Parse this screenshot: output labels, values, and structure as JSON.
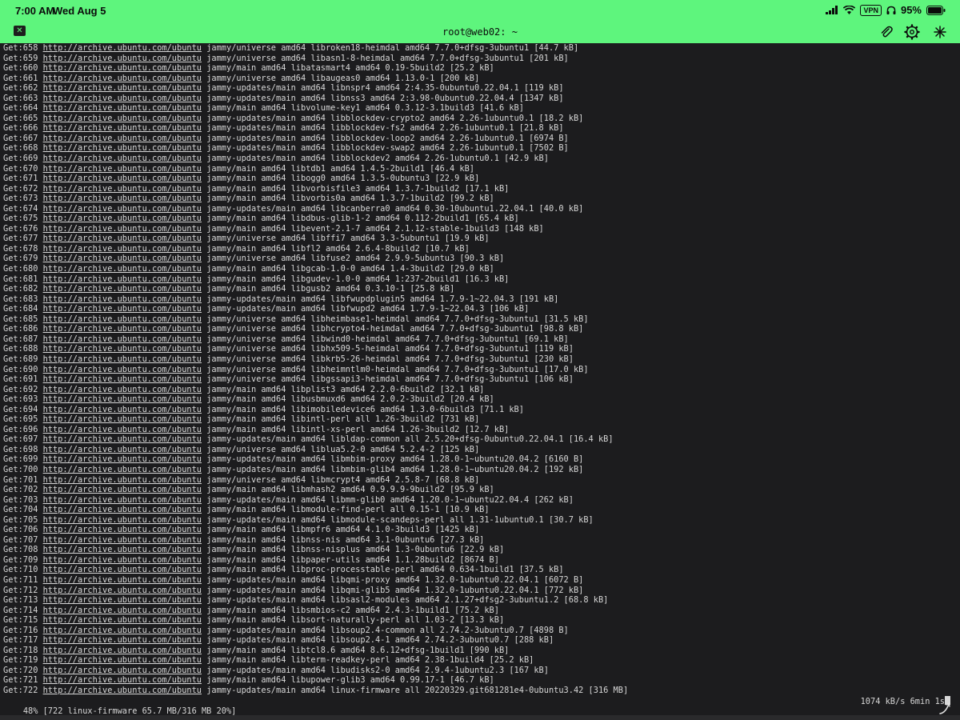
{
  "status_bar": {
    "time": "7:00 AM",
    "date": "Wed Aug 5",
    "vpn": "VPN",
    "battery": "95%"
  },
  "window": {
    "title": "root@web02: ~",
    "close_symbol": "✕",
    "icons": [
      "paperclip-icon",
      "gear-icon",
      "more-icon"
    ]
  },
  "colors": {
    "accent": "#5ef57d",
    "terminal_bg": "#1c1c1e",
    "terminal_fg": "#d8d8d8"
  },
  "terminal": {
    "lines": [
      {
        "prefix": "Get:658",
        "url": "http://archive.ubuntu.com/ubuntu",
        "rest": "jammy/universe amd64 libroken18-heimdal amd64 7.7.0+dfsg-3ubuntu1 [44.7 kB]"
      },
      {
        "prefix": "Get:659",
        "url": "http://archive.ubuntu.com/ubuntu",
        "rest": "jammy/universe amd64 libasn1-8-heimdal amd64 7.7.0+dfsg-3ubuntu1 [201 kB]"
      },
      {
        "prefix": "Get:660",
        "url": "http://archive.ubuntu.com/ubuntu",
        "rest": "jammy/main amd64 libatasmart4 amd64 0.19-5build2 [25.2 kB]"
      },
      {
        "prefix": "Get:661",
        "url": "http://archive.ubuntu.com/ubuntu",
        "rest": "jammy/universe amd64 libaugeas0 amd64 1.13.0-1 [200 kB]"
      },
      {
        "prefix": "Get:662",
        "url": "http://archive.ubuntu.com/ubuntu",
        "rest": "jammy-updates/main amd64 libnspr4 amd64 2:4.35-0ubuntu0.22.04.1 [119 kB]"
      },
      {
        "prefix": "Get:663",
        "url": "http://archive.ubuntu.com/ubuntu",
        "rest": "jammy-updates/main amd64 libnss3 amd64 2:3.98-0ubuntu0.22.04.4 [1347 kB]"
      },
      {
        "prefix": "Get:664",
        "url": "http://archive.ubuntu.com/ubuntu",
        "rest": "jammy/main amd64 libvolume-key1 amd64 0.3.12-3.1build3 [41.6 kB]"
      },
      {
        "prefix": "Get:665",
        "url": "http://archive.ubuntu.com/ubuntu",
        "rest": "jammy-updates/main amd64 libblockdev-crypto2 amd64 2.26-1ubuntu0.1 [18.2 kB]"
      },
      {
        "prefix": "Get:666",
        "url": "http://archive.ubuntu.com/ubuntu",
        "rest": "jammy-updates/main amd64 libblockdev-fs2 amd64 2.26-1ubuntu0.1 [21.8 kB]"
      },
      {
        "prefix": "Get:667",
        "url": "http://archive.ubuntu.com/ubuntu",
        "rest": "jammy-updates/main amd64 libblockdev-loop2 amd64 2.26-1ubuntu0.1 [6974 B]"
      },
      {
        "prefix": "Get:668",
        "url": "http://archive.ubuntu.com/ubuntu",
        "rest": "jammy-updates/main amd64 libblockdev-swap2 amd64 2.26-1ubuntu0.1 [7502 B]"
      },
      {
        "prefix": "Get:669",
        "url": "http://archive.ubuntu.com/ubuntu",
        "rest": "jammy-updates/main amd64 libblockdev2 amd64 2.26-1ubuntu0.1 [42.9 kB]"
      },
      {
        "prefix": "Get:670",
        "url": "http://archive.ubuntu.com/ubuntu",
        "rest": "jammy/main amd64 libtdb1 amd64 1.4.5-2build1 [46.4 kB]"
      },
      {
        "prefix": "Get:671",
        "url": "http://archive.ubuntu.com/ubuntu",
        "rest": "jammy/main amd64 libogg0 amd64 1.3.5-0ubuntu3 [22.9 kB]"
      },
      {
        "prefix": "Get:672",
        "url": "http://archive.ubuntu.com/ubuntu",
        "rest": "jammy/main amd64 libvorbisfile3 amd64 1.3.7-1build2 [17.1 kB]"
      },
      {
        "prefix": "Get:673",
        "url": "http://archive.ubuntu.com/ubuntu",
        "rest": "jammy/main amd64 libvorbis0a amd64 1.3.7-1build2 [99.2 kB]"
      },
      {
        "prefix": "Get:674",
        "url": "http://archive.ubuntu.com/ubuntu",
        "rest": "jammy-updates/main amd64 libcanberra0 amd64 0.30-10ubuntu1.22.04.1 [40.0 kB]"
      },
      {
        "prefix": "Get:675",
        "url": "http://archive.ubuntu.com/ubuntu",
        "rest": "jammy/main amd64 libdbus-glib-1-2 amd64 0.112-2build1 [65.4 kB]"
      },
      {
        "prefix": "Get:676",
        "url": "http://archive.ubuntu.com/ubuntu",
        "rest": "jammy/main amd64 libevent-2.1-7 amd64 2.1.12-stable-1build3 [148 kB]"
      },
      {
        "prefix": "Get:677",
        "url": "http://archive.ubuntu.com/ubuntu",
        "rest": "jammy/universe amd64 libffi7 amd64 3.3-5ubuntu1 [19.9 kB]"
      },
      {
        "prefix": "Get:678",
        "url": "http://archive.ubuntu.com/ubuntu",
        "rest": "jammy/main amd64 libfl2 amd64 2.6.4-8build2 [10.7 kB]"
      },
      {
        "prefix": "Get:679",
        "url": "http://archive.ubuntu.com/ubuntu",
        "rest": "jammy/universe amd64 libfuse2 amd64 2.9.9-5ubuntu3 [90.3 kB]"
      },
      {
        "prefix": "Get:680",
        "url": "http://archive.ubuntu.com/ubuntu",
        "rest": "jammy/main amd64 libgcab-1.0-0 amd64 1.4-3build2 [29.0 kB]"
      },
      {
        "prefix": "Get:681",
        "url": "http://archive.ubuntu.com/ubuntu",
        "rest": "jammy/main amd64 libgudev-1.0-0 amd64 1:237-2build1 [16.3 kB]"
      },
      {
        "prefix": "Get:682",
        "url": "http://archive.ubuntu.com/ubuntu",
        "rest": "jammy/main amd64 libgusb2 amd64 0.3.10-1 [25.8 kB]"
      },
      {
        "prefix": "Get:683",
        "url": "http://archive.ubuntu.com/ubuntu",
        "rest": "jammy-updates/main amd64 libfwupdplugin5 amd64 1.7.9-1~22.04.3 [191 kB]"
      },
      {
        "prefix": "Get:684",
        "url": "http://archive.ubuntu.com/ubuntu",
        "rest": "jammy-updates/main amd64 libfwupd2 amd64 1.7.9-1~22.04.3 [106 kB]"
      },
      {
        "prefix": "Get:685",
        "url": "http://archive.ubuntu.com/ubuntu",
        "rest": "jammy/universe amd64 libheimbase1-heimdal amd64 7.7.0+dfsg-3ubuntu1 [31.5 kB]"
      },
      {
        "prefix": "Get:686",
        "url": "http://archive.ubuntu.com/ubuntu",
        "rest": "jammy/universe amd64 libhcrypto4-heimdal amd64 7.7.0+dfsg-3ubuntu1 [98.8 kB]"
      },
      {
        "prefix": "Get:687",
        "url": "http://archive.ubuntu.com/ubuntu",
        "rest": "jammy/universe amd64 libwind0-heimdal amd64 7.7.0+dfsg-3ubuntu1 [69.1 kB]"
      },
      {
        "prefix": "Get:688",
        "url": "http://archive.ubuntu.com/ubuntu",
        "rest": "jammy/universe amd64 libhx509-5-heimdal amd64 7.7.0+dfsg-3ubuntu1 [119 kB]"
      },
      {
        "prefix": "Get:689",
        "url": "http://archive.ubuntu.com/ubuntu",
        "rest": "jammy/universe amd64 libkrb5-26-heimdal amd64 7.7.0+dfsg-3ubuntu1 [230 kB]"
      },
      {
        "prefix": "Get:690",
        "url": "http://archive.ubuntu.com/ubuntu",
        "rest": "jammy/universe amd64 libheimntlm0-heimdal amd64 7.7.0+dfsg-3ubuntu1 [17.0 kB]"
      },
      {
        "prefix": "Get:691",
        "url": "http://archive.ubuntu.com/ubuntu",
        "rest": "jammy/universe amd64 libgssapi3-heimdal amd64 7.7.0+dfsg-3ubuntu1 [106 kB]"
      },
      {
        "prefix": "Get:692",
        "url": "http://archive.ubuntu.com/ubuntu",
        "rest": "jammy/main amd64 libplist3 amd64 2.2.0-6build2 [32.1 kB]"
      },
      {
        "prefix": "Get:693",
        "url": "http://archive.ubuntu.com/ubuntu",
        "rest": "jammy/main amd64 libusbmuxd6 amd64 2.0.2-3build2 [20.4 kB]"
      },
      {
        "prefix": "Get:694",
        "url": "http://archive.ubuntu.com/ubuntu",
        "rest": "jammy/main amd64 libimobiledevice6 amd64 1.3.0-6build3 [71.1 kB]"
      },
      {
        "prefix": "Get:695",
        "url": "http://archive.ubuntu.com/ubuntu",
        "rest": "jammy/main amd64 libintl-perl all 1.26-3build2 [731 kB]"
      },
      {
        "prefix": "Get:696",
        "url": "http://archive.ubuntu.com/ubuntu",
        "rest": "jammy/main amd64 libintl-xs-perl amd64 1.26-3build2 [12.7 kB]"
      },
      {
        "prefix": "Get:697",
        "url": "http://archive.ubuntu.com/ubuntu",
        "rest": "jammy-updates/main amd64 libldap-common all 2.5.20+dfsg-0ubuntu0.22.04.1 [16.4 kB]"
      },
      {
        "prefix": "Get:698",
        "url": "http://archive.ubuntu.com/ubuntu",
        "rest": "jammy/universe amd64 liblua5.2-0 amd64 5.2.4-2 [125 kB]"
      },
      {
        "prefix": "Get:699",
        "url": "http://archive.ubuntu.com/ubuntu",
        "rest": "jammy-updates/main amd64 libmbim-proxy amd64 1.28.0-1~ubuntu20.04.2 [6160 B]"
      },
      {
        "prefix": "Get:700",
        "url": "http://archive.ubuntu.com/ubuntu",
        "rest": "jammy-updates/main amd64 libmbim-glib4 amd64 1.28.0-1~ubuntu20.04.2 [192 kB]"
      },
      {
        "prefix": "Get:701",
        "url": "http://archive.ubuntu.com/ubuntu",
        "rest": "jammy/universe amd64 libmcrypt4 amd64 2.5.8-7 [68.8 kB]"
      },
      {
        "prefix": "Get:702",
        "url": "http://archive.ubuntu.com/ubuntu",
        "rest": "jammy/main amd64 libmhash2 amd64 0.9.9.9-9build2 [95.9 kB]"
      },
      {
        "prefix": "Get:703",
        "url": "http://archive.ubuntu.com/ubuntu",
        "rest": "jammy-updates/main amd64 libmm-glib0 amd64 1.20.0-1~ubuntu22.04.4 [262 kB]"
      },
      {
        "prefix": "Get:704",
        "url": "http://archive.ubuntu.com/ubuntu",
        "rest": "jammy/main amd64 libmodule-find-perl all 0.15-1 [10.9 kB]"
      },
      {
        "prefix": "Get:705",
        "url": "http://archive.ubuntu.com/ubuntu",
        "rest": "jammy-updates/main amd64 libmodule-scandeps-perl all 1.31-1ubuntu0.1 [30.7 kB]"
      },
      {
        "prefix": "Get:706",
        "url": "http://archive.ubuntu.com/ubuntu",
        "rest": "jammy/main amd64 libmpfr6 amd64 4.1.0-3build3 [1425 kB]"
      },
      {
        "prefix": "Get:707",
        "url": "http://archive.ubuntu.com/ubuntu",
        "rest": "jammy/main amd64 libnss-nis amd64 3.1-0ubuntu6 [27.3 kB]"
      },
      {
        "prefix": "Get:708",
        "url": "http://archive.ubuntu.com/ubuntu",
        "rest": "jammy/main amd64 libnss-nisplus amd64 1.3-0ubuntu6 [22.9 kB]"
      },
      {
        "prefix": "Get:709",
        "url": "http://archive.ubuntu.com/ubuntu",
        "rest": "jammy/main amd64 libpaper-utils amd64 1.1.28build2 [8674 B]"
      },
      {
        "prefix": "Get:710",
        "url": "http://archive.ubuntu.com/ubuntu",
        "rest": "jammy/main amd64 libproc-processtable-perl amd64 0.634-1build1 [37.5 kB]"
      },
      {
        "prefix": "Get:711",
        "url": "http://archive.ubuntu.com/ubuntu",
        "rest": "jammy-updates/main amd64 libqmi-proxy amd64 1.32.0-1ubuntu0.22.04.1 [6072 B]"
      },
      {
        "prefix": "Get:712",
        "url": "http://archive.ubuntu.com/ubuntu",
        "rest": "jammy-updates/main amd64 libqmi-glib5 amd64 1.32.0-1ubuntu0.22.04.1 [772 kB]"
      },
      {
        "prefix": "Get:713",
        "url": "http://archive.ubuntu.com/ubuntu",
        "rest": "jammy-updates/main amd64 libsasl2-modules amd64 2.1.27+dfsg2-3ubuntu1.2 [68.8 kB]"
      },
      {
        "prefix": "Get:714",
        "url": "http://archive.ubuntu.com/ubuntu",
        "rest": "jammy/main amd64 libsmbios-c2 amd64 2.4.3-1build1 [75.2 kB]"
      },
      {
        "prefix": "Get:715",
        "url": "http://archive.ubuntu.com/ubuntu",
        "rest": "jammy/main amd64 libsort-naturally-perl all 1.03-2 [13.3 kB]"
      },
      {
        "prefix": "Get:716",
        "url": "http://archive.ubuntu.com/ubuntu",
        "rest": "jammy-updates/main amd64 libsoup2.4-common all 2.74.2-3ubuntu0.7 [4898 B]"
      },
      {
        "prefix": "Get:717",
        "url": "http://archive.ubuntu.com/ubuntu",
        "rest": "jammy-updates/main amd64 libsoup2.4-1 amd64 2.74.2-3ubuntu0.7 [288 kB]"
      },
      {
        "prefix": "Get:718",
        "url": "http://archive.ubuntu.com/ubuntu",
        "rest": "jammy/main amd64 libtcl8.6 amd64 8.6.12+dfsg-1build1 [990 kB]"
      },
      {
        "prefix": "Get:719",
        "url": "http://archive.ubuntu.com/ubuntu",
        "rest": "jammy/main amd64 libterm-readkey-perl amd64 2.38-1build4 [25.2 kB]"
      },
      {
        "prefix": "Get:720",
        "url": "http://archive.ubuntu.com/ubuntu",
        "rest": "jammy-updates/main amd64 libudisks2-0 amd64 2.9.4-1ubuntu2.3 [167 kB]"
      },
      {
        "prefix": "Get:721",
        "url": "http://archive.ubuntu.com/ubuntu",
        "rest": "jammy/main amd64 libupower-glib3 amd64 0.99.17-1 [46.7 kB]"
      },
      {
        "prefix": "Get:722",
        "url": "http://archive.ubuntu.com/ubuntu",
        "rest": "jammy-updates/main amd64 linux-firmware all 20220329.git681281e4-0ubuntu3.42 [316 MB]"
      }
    ],
    "progress_left": "48% [722 linux-firmware 65.7 MB/316 MB 20%]",
    "progress_right": "1074 kB/s 6min 1s"
  }
}
